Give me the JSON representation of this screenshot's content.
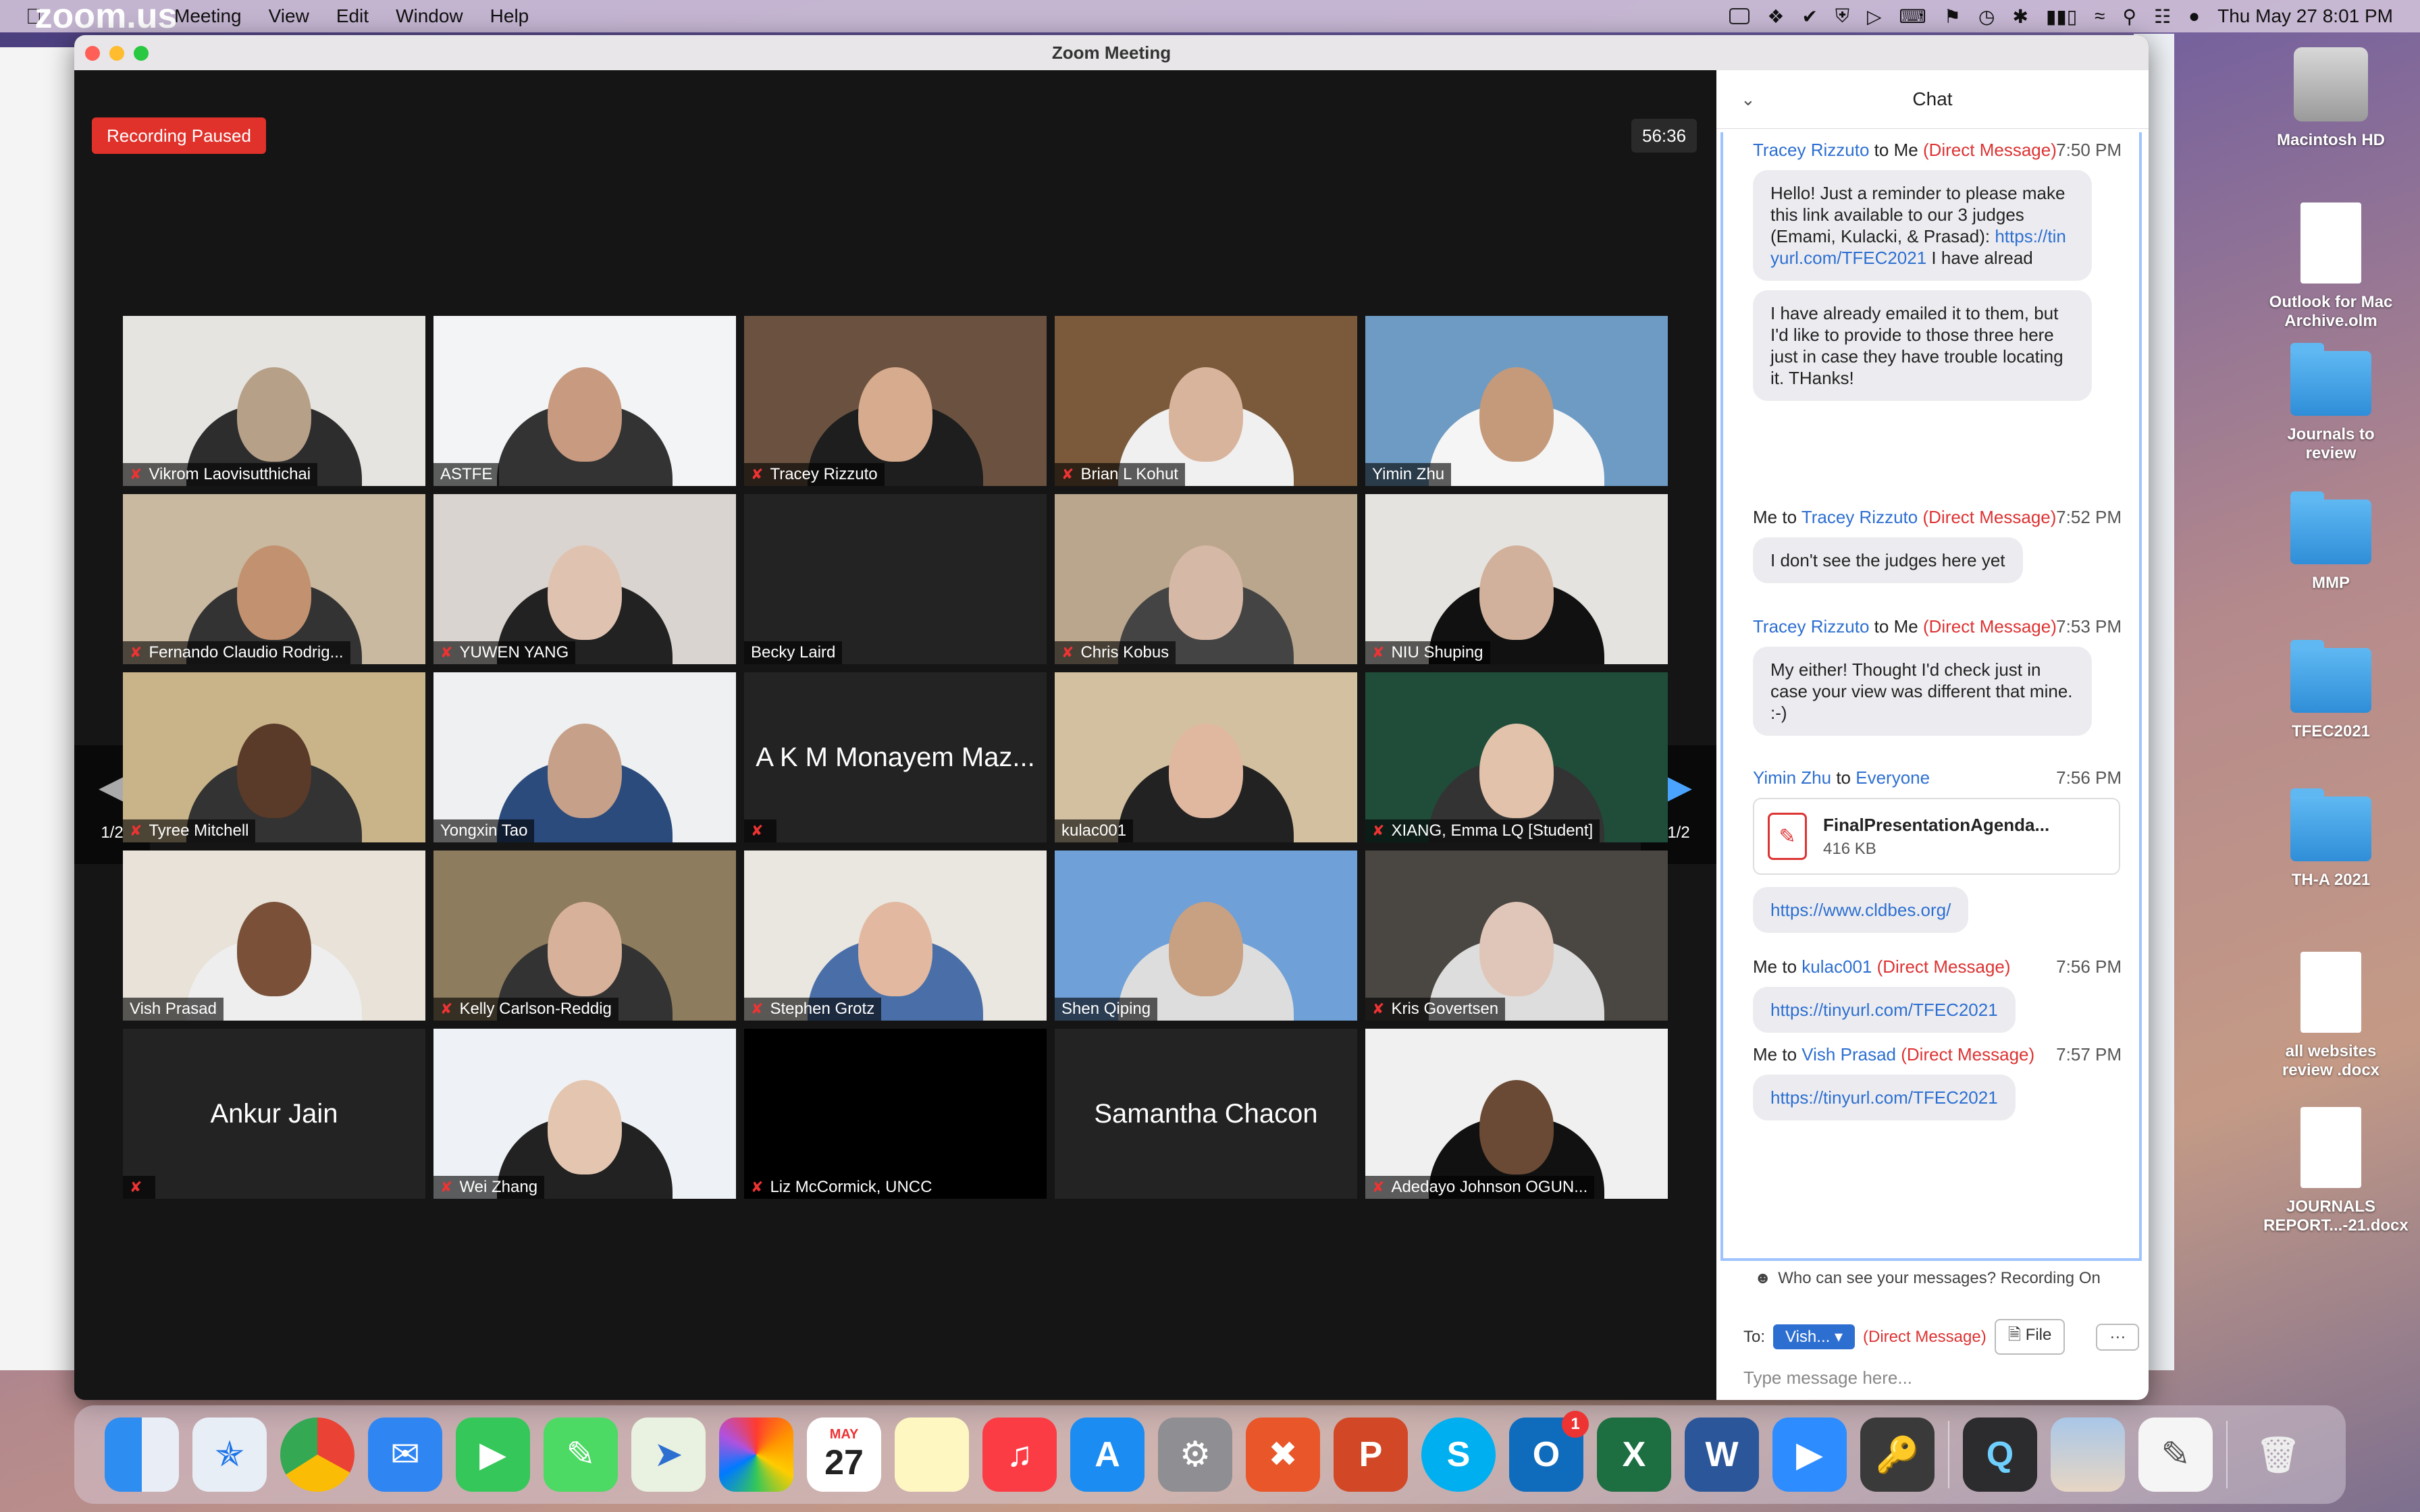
{
  "menubar": {
    "app": "zoom.us",
    "items": [
      "Meeting",
      "View",
      "Edit",
      "Window",
      "Help"
    ],
    "datetime": "Thu May 27  8:01 PM"
  },
  "window": {
    "title": "Zoom Meeting"
  },
  "meeting": {
    "recording_status": "Recording Paused",
    "timer": "56:36",
    "page_left": "1/2",
    "page_right": "1/2"
  },
  "participants": [
    {
      "name": "Vikrom Laovisutthichai",
      "muted": true
    },
    {
      "name": "ASTFE",
      "muted": false
    },
    {
      "name": "Tracey Rizzuto",
      "muted": true
    },
    {
      "name": "Brian L Kohut",
      "muted": true
    },
    {
      "name": "Yimin Zhu",
      "muted": false,
      "speaking": true
    },
    {
      "name": "Fernando Claudio Rodrig...",
      "muted": true
    },
    {
      "name": "YUWEN YANG",
      "muted": true
    },
    {
      "name": "Becky Laird",
      "muted": false
    },
    {
      "name": "Chris Kobus",
      "muted": true
    },
    {
      "name": "NIU Shuping",
      "muted": true
    },
    {
      "name": "Tyree Mitchell",
      "muted": true
    },
    {
      "name": "Yongxin Tao",
      "muted": false
    },
    {
      "name": "A K M Monayem Maz...",
      "muted": true,
      "video_off": true
    },
    {
      "name": "kulac001",
      "muted": false
    },
    {
      "name": "XIANG, Emma LQ [Student]",
      "muted": true
    },
    {
      "name": "Vish Prasad",
      "muted": false
    },
    {
      "name": "Kelly Carlson-Reddig",
      "muted": true
    },
    {
      "name": "Stephen Grotz",
      "muted": true
    },
    {
      "name": "Shen Qiping",
      "muted": false
    },
    {
      "name": "Kris Govertsen",
      "muted": true
    },
    {
      "name": "Ankur Jain",
      "muted": true,
      "video_off": true
    },
    {
      "name": "Wei Zhang",
      "muted": true
    },
    {
      "name": "Liz McCormick, UNCC",
      "muted": true
    },
    {
      "name": "Samantha Chacon",
      "muted": false,
      "video_off": true
    },
    {
      "name": "Adedayo Johnson OGUN...",
      "muted": true
    }
  ],
  "chat": {
    "title": "Chat",
    "messages": [
      {
        "from": "Tracey Rizzuto",
        "to_word": "to",
        "to": "Me",
        "tag": "(Direct Message)",
        "time": "7:50 PM"
      },
      {
        "bubble1": "Hello! Just a reminder to please make this link available to our 3 judges (Emami, Kulacki, & Prasad):",
        "link1": "https://tinyurl.com/TFEC2021",
        "tail1": "I have alread",
        "bubble2": "I have already emailed it to them, but I'd like to provide to those three here just in case they have trouble locating it. THanks!"
      },
      {
        "from": "Me",
        "to_word": "to",
        "to": "Tracey Rizzuto",
        "tag": "(Direct Message)",
        "time": "7:52 PM",
        "bubble": "I don't see the judges here yet"
      },
      {
        "from": "Tracey Rizzuto",
        "to_word": "to",
        "to": "Me",
        "tag": "(Direct Message)",
        "time": "7:53 PM",
        "bubble": "My either! Thought I'd check just in case your view was different that mine. :-)"
      },
      {
        "from": "Yimin Zhu",
        "to_word": "to",
        "to": "Everyone",
        "time": "7:56 PM",
        "file_name": "FinalPresentationAgenda...",
        "file_size": "416 KB",
        "link": "https://www.cldbes.org/"
      },
      {
        "from": "Me",
        "to_word": "to",
        "to": "kulac001",
        "tag": "(Direct Message)",
        "time": "7:56 PM",
        "link": "https://tinyurl.com/TFEC2021"
      },
      {
        "from": "Me",
        "to_word": "to",
        "to": "Vish Prasad",
        "tag": "(Direct Message)",
        "time": "7:57 PM",
        "link": "https://tinyurl.com/TFEC2021"
      }
    ],
    "who_can_see": "Who can see your messages? Recording On",
    "to_label": "To:",
    "to_value": "Vish...",
    "to_tag": "(Direct Message)",
    "file_btn": "File",
    "more_btn": "···",
    "placeholder": "Type message here..."
  },
  "desktop": [
    {
      "label": "Macintosh HD",
      "kind": "hd"
    },
    {
      "label": "Outlook for Mac Archive.olm",
      "kind": "doc"
    },
    {
      "label": "Journals to review",
      "kind": "folder"
    },
    {
      "label": "MMP",
      "kind": "folder"
    },
    {
      "label": "TFEC2021",
      "kind": "folder"
    },
    {
      "label": "TH-A 2021",
      "kind": "folder"
    },
    {
      "label": "all websites review .docx",
      "kind": "doc"
    },
    {
      "label": "JOURNALS REPORT...-21.docx",
      "kind": "doc"
    }
  ],
  "dock": {
    "calendar_month": "MAY",
    "calendar_day": "27",
    "outlook_badge": "1"
  }
}
